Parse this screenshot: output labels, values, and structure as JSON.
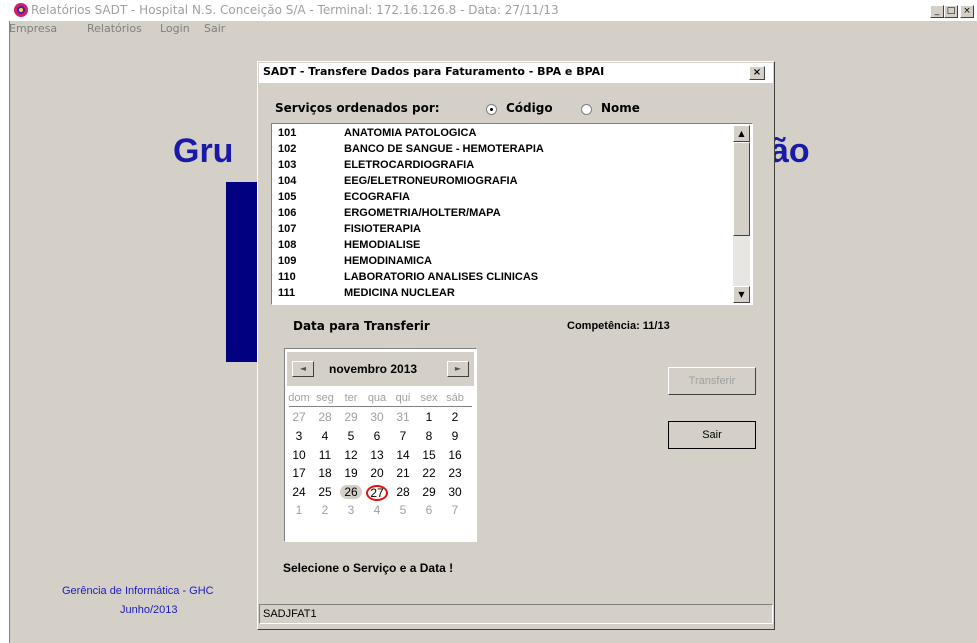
{
  "window": {
    "title": "Relatórios SADT - Hospital N.S. Conceição S/A - Terminal: 172.16.126.8 - Data: 27/11/13",
    "minimize": "_",
    "maximize": "□",
    "close": "×"
  },
  "menu": [
    "Empresa",
    "Relatórios",
    "Login",
    "Sair"
  ],
  "background": {
    "title_left": "Gru",
    "title_right": "ão",
    "footer_line1": "Gerência de Informática - GHC",
    "footer_line2": "Junho/2013"
  },
  "dialog": {
    "title": "SADT - Transfere Dados para Faturamento  -  BPA e BPAI",
    "close": "×",
    "sort_label": "Serviços ordenados por:",
    "sort_options": [
      {
        "label": "Código",
        "selected": true
      },
      {
        "label": "Nome",
        "selected": false
      }
    ],
    "services": [
      {
        "code": "101",
        "name": "ANATOMIA PATOLOGICA"
      },
      {
        "code": "102",
        "name": "BANCO DE SANGUE - HEMOTERAPIA"
      },
      {
        "code": "103",
        "name": "ELETROCARDIOGRAFIA"
      },
      {
        "code": "104",
        "name": "EEG/ELETRONEUROMIOGRAFIA"
      },
      {
        "code": "105",
        "name": "ECOGRAFIA"
      },
      {
        "code": "106",
        "name": "ERGOMETRIA/HOLTER/MAPA"
      },
      {
        "code": "107",
        "name": "FISIOTERAPIA"
      },
      {
        "code": "108",
        "name": "HEMODIALISE"
      },
      {
        "code": "109",
        "name": "HEMODINAMICA"
      },
      {
        "code": "110",
        "name": "LABORATORIO ANALISES CLINICAS"
      },
      {
        "code": "111",
        "name": "MEDICINA NUCLEAR"
      }
    ],
    "date_label": "Data para Transferir",
    "competencia": "Competência: 11/13",
    "calendar": {
      "month": "novembro 2013",
      "prev": "◄",
      "next": "►",
      "weekdays": [
        "dom",
        "seg",
        "ter",
        "qua",
        "qui",
        "sex",
        "sáb"
      ],
      "weeks": [
        [
          "27",
          "28",
          "29",
          "30",
          "31",
          "1",
          "2"
        ],
        [
          "3",
          "4",
          "5",
          "6",
          "7",
          "8",
          "9"
        ],
        [
          "10",
          "11",
          "12",
          "13",
          "14",
          "15",
          "16"
        ],
        [
          "17",
          "18",
          "19",
          "20",
          "21",
          "22",
          "23"
        ],
        [
          "24",
          "25",
          "26",
          "27",
          "28",
          "29",
          "30"
        ],
        [
          "1",
          "2",
          "3",
          "4",
          "5",
          "6",
          "7"
        ]
      ],
      "selected": "26",
      "today": "27"
    },
    "transfer_button": "Transferir",
    "exit_button": "Sair",
    "hint": "Selecione o Serviço e a Data !",
    "status": "SADJFAT1"
  }
}
